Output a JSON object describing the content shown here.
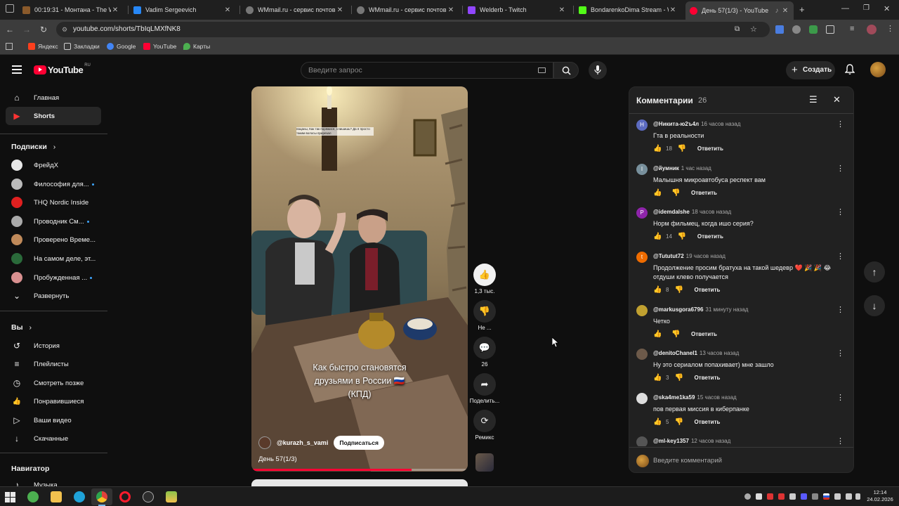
{
  "browser": {
    "tabs": [
      {
        "title": "00:19:31 - Монтана - The West",
        "color": "#8a5a2b"
      },
      {
        "title": "Vadim Sergeevich",
        "color": "#2787f5"
      },
      {
        "title": "WMmail.ru - сервис почтовых",
        "color": "#777777"
      },
      {
        "title": "WMmail.ru - сервис почтовых",
        "color": "#777777"
      },
      {
        "title": "Welderb - Twitch",
        "color": "#9146ff"
      },
      {
        "title": "BondarenkoDima Stream - Wat",
        "color": "#53fc18"
      },
      {
        "title": "День 57(1/3) - YouTube",
        "color": "#ff0033"
      }
    ],
    "new_tab": "+",
    "url": "youtube.com/shorts/TbIqLMXfNK8",
    "bookmarks": [
      {
        "label": "Яндекс",
        "color": "#fc3f1d"
      },
      {
        "label": "Закладки",
        "color": "#cfcfcf"
      },
      {
        "label": "Google",
        "color": "#4285f4"
      },
      {
        "label": "YouTube",
        "color": "#ff0033"
      },
      {
        "label": "Карты",
        "color": "#4caf50"
      }
    ]
  },
  "header": {
    "logo_text": "YouTube",
    "logo_region": "RU",
    "search_placeholder": "Введите запрос",
    "create_label": "Создать"
  },
  "sidebar": {
    "main": [
      {
        "label": "Главная",
        "icon": "home-icon",
        "glyph": "⌂"
      },
      {
        "label": "Shorts",
        "icon": "shorts-icon",
        "glyph": "▶"
      }
    ],
    "subscriptions_title": "Подписки",
    "subscriptions": [
      {
        "label": "ФрейдХ",
        "color": "#e8e8e8",
        "dot": false
      },
      {
        "label": "Философия для...",
        "color": "#bbbbbb",
        "dot": true
      },
      {
        "label": "THQ Nordic Inside",
        "color": "#e02020",
        "dot": false
      },
      {
        "label": "Проводник См...",
        "color": "#aaaaaa",
        "dot": true
      },
      {
        "label": "Проверено Време...",
        "color": "#c08a5a",
        "dot": false
      },
      {
        "label": "На самом деле, эт...",
        "color": "#2a6a3a",
        "dot": false
      },
      {
        "label": "Пробужденная ...",
        "color": "#d99090",
        "dot": true
      }
    ],
    "expand_label": "Развернуть",
    "you_title": "Вы",
    "you_items": [
      {
        "label": "История",
        "glyph": "↺"
      },
      {
        "label": "Плейлисты",
        "glyph": "≡"
      },
      {
        "label": "Смотреть позже",
        "glyph": "◷"
      },
      {
        "label": "Понравившиеся",
        "glyph": "👍"
      },
      {
        "label": "Ваши видео",
        "glyph": "▷"
      },
      {
        "label": "Скачанные",
        "glyph": "↓"
      }
    ],
    "navigator_title": "Навигатор",
    "navigator_items": [
      {
        "label": "Музыка",
        "glyph": "♪"
      }
    ]
  },
  "video": {
    "caption_line1": "Как быстро становятся",
    "caption_line2": "друзьями в России 🇷🇺",
    "caption_line3": "(КПД)",
    "overlay_text": "пацаны, Как так поряжися, слишишь? Да я просто таким волосы прирезал",
    "channel": "@kurazh_s_vami",
    "subscribe_label": "Подписаться",
    "title": "День 57(1/3)",
    "progress": 0.74
  },
  "actions": {
    "likes": "1,3 тыс.",
    "dislike_label": "Не ...",
    "comments": "26",
    "share_label": "Поделить...",
    "remix_label": "Ремикс"
  },
  "comments": {
    "title": "Комментарии",
    "count": "26",
    "reply_label": "Ответить",
    "input_placeholder": "Введите комментарий",
    "items": [
      {
        "author": "@Никита-ю2ъ4л",
        "time": "16 часов назад",
        "text": "Гта в реальности",
        "likes": "18",
        "avatar_letter": "Н",
        "avatar_color": "#5c6bc0"
      },
      {
        "author": "@йумник",
        "time": "1 час назад",
        "text": "Малышня микроавтобуса респект вам",
        "likes": "",
        "avatar_letter": "I",
        "avatar_color": "#78909c"
      },
      {
        "author": "@idemdalshe",
        "time": "18 часов назад",
        "text": "Норм фильмец, когда ишо серия?",
        "likes": "14",
        "avatar_letter": "P",
        "avatar_color": "#8e24aa"
      },
      {
        "author": "@Tututut72",
        "time": "19 часов назад",
        "text": "Продолжение просим братуха на такой шедевр ❤️ 🎉 🎉 😂 отдуши клево получается",
        "likes": "8",
        "avatar_letter": "t",
        "avatar_color": "#ef6c00"
      },
      {
        "author": "@markusgora6796",
        "time": "31 минуту назад",
        "text": "Четко",
        "likes": "",
        "avatar_letter": "",
        "avatar_color": "#c0a030"
      },
      {
        "author": "@denitoChanel1",
        "time": "13 часов назад",
        "text": "Ну это сериалом попахивает) мне зашло",
        "likes": "3",
        "avatar_letter": "",
        "avatar_color": "#6d5a4a"
      },
      {
        "author": "@ska4me1ka59",
        "time": "15 часов назад",
        "text": "пов первая миссия в киберпанке",
        "likes": "5",
        "avatar_letter": "",
        "avatar_color": "#dddddd"
      },
      {
        "author": "@ml-key1357",
        "time": "12 часов назад",
        "text": "",
        "likes": "",
        "avatar_letter": "",
        "avatar_color": "#555555"
      }
    ]
  },
  "taskbar": {
    "time": "12:14",
    "date": "24.02.2026",
    "apps": [
      {
        "name": "windows-start-icon",
        "color": "#e8e8e8"
      },
      {
        "name": "app-green-icon",
        "color": "#4caf50"
      },
      {
        "name": "file-explorer-icon",
        "color": "#f2c14e"
      },
      {
        "name": "edge-icon",
        "color": "#1fa2d8"
      },
      {
        "name": "chrome-icon",
        "color": "#e0413a"
      },
      {
        "name": "opera-icon",
        "color": "#ff1b2d"
      },
      {
        "name": "app-dark-icon",
        "color": "#2d2d2d"
      },
      {
        "name": "app-stack-icon",
        "color": "#8bc34a"
      }
    ]
  }
}
